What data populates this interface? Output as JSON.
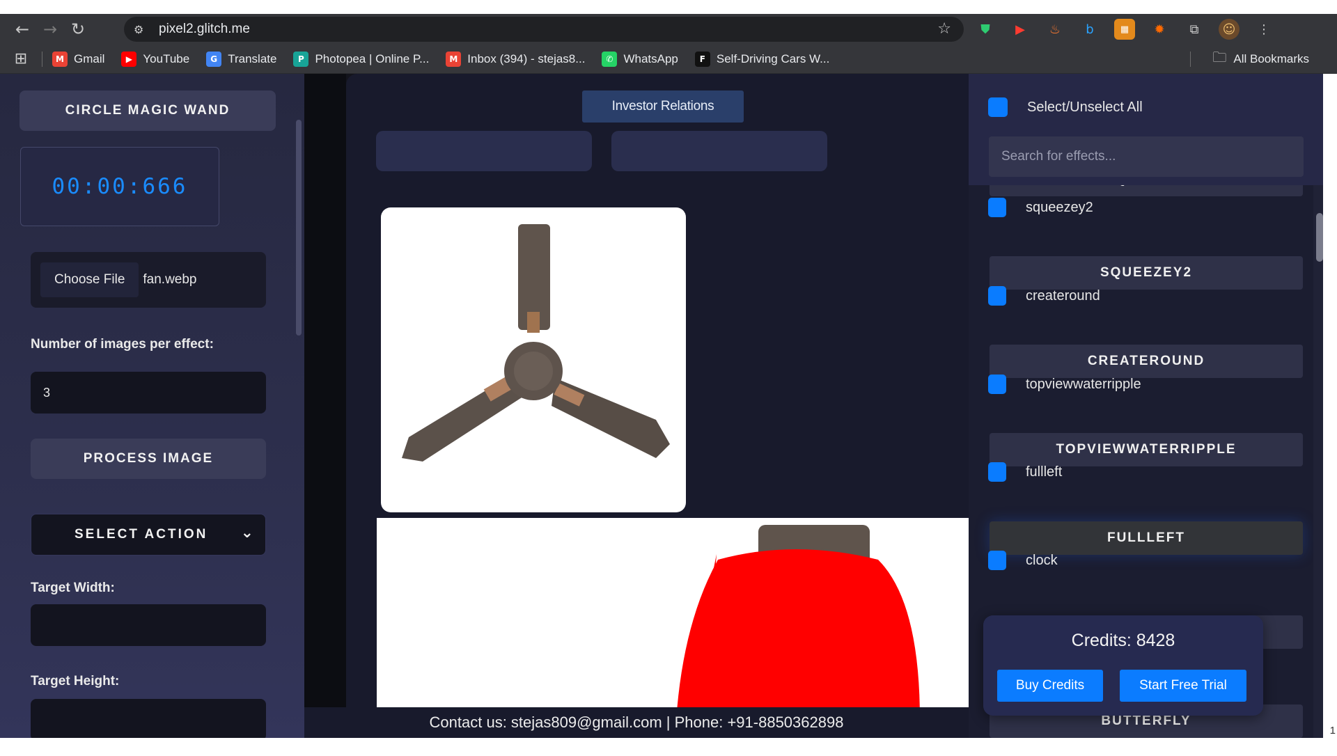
{
  "browser": {
    "url": "pixel2.glitch.me",
    "bookmarks": [
      {
        "label": "Gmail",
        "icon": "gmail-icon",
        "color": "#ea4335",
        "glyph": "M"
      },
      {
        "label": "YouTube",
        "icon": "youtube-icon",
        "color": "#ff0000",
        "glyph": "▶"
      },
      {
        "label": "Translate",
        "icon": "translate-icon",
        "color": "#4285f4",
        "glyph": "G"
      },
      {
        "label": "Photopea | Online P...",
        "icon": "photopea-icon",
        "color": "#18a497",
        "glyph": "P"
      },
      {
        "label": "Inbox (394) - stejas8...",
        "icon": "gmail-icon",
        "color": "#ea4335",
        "glyph": "M"
      },
      {
        "label": "WhatsApp",
        "icon": "whatsapp-icon",
        "color": "#25d366",
        "glyph": "✆"
      },
      {
        "label": "Self-Driving Cars W...",
        "icon": "f-icon",
        "color": "#111111",
        "glyph": "F"
      }
    ],
    "all_bookmarks": "All Bookmarks"
  },
  "sidebar": {
    "magic_wand": "CIRCLE MAGIC WAND",
    "timer": "00:00:666",
    "choose_file": "Choose File",
    "file_name": "fan.webp",
    "images_per_effect_label": "Number of images per effect:",
    "images_per_effect_value": "3",
    "process_button": "PROCESS IMAGE",
    "select_action": "SELECT ACTION",
    "target_width_label": "Target Width:",
    "target_height_label": "Target Height:"
  },
  "center": {
    "tab_label": "Investor Relations"
  },
  "footer": {
    "contact": "Contact us: stejas809@gmail.com | Phone: +91-8850362898"
  },
  "effects_panel": {
    "select_all": "Select/Unselect All",
    "search_placeholder": "Search for effects...",
    "hidden_head": "SQUEEZEZ",
    "rows": [
      {
        "label": "squeezey2",
        "head": "SQUEEZEY2"
      },
      {
        "label": "createround",
        "head": "CREATEROUND"
      },
      {
        "label": "topviewwaterripple",
        "head": "TOPVIEWWATERRIPPLE"
      },
      {
        "label": "fullleft",
        "head": "FULLLEFT"
      },
      {
        "label": "clock",
        "head": ""
      }
    ],
    "bottom_head": "BUTTERFLY"
  },
  "credits": {
    "title": "Credits: 8428",
    "buy": "Buy Credits",
    "trial": "Start Free Trial"
  },
  "colors": {
    "accent": "#0b7cff",
    "timer": "#1a8cff",
    "brush": "#ff0000"
  }
}
